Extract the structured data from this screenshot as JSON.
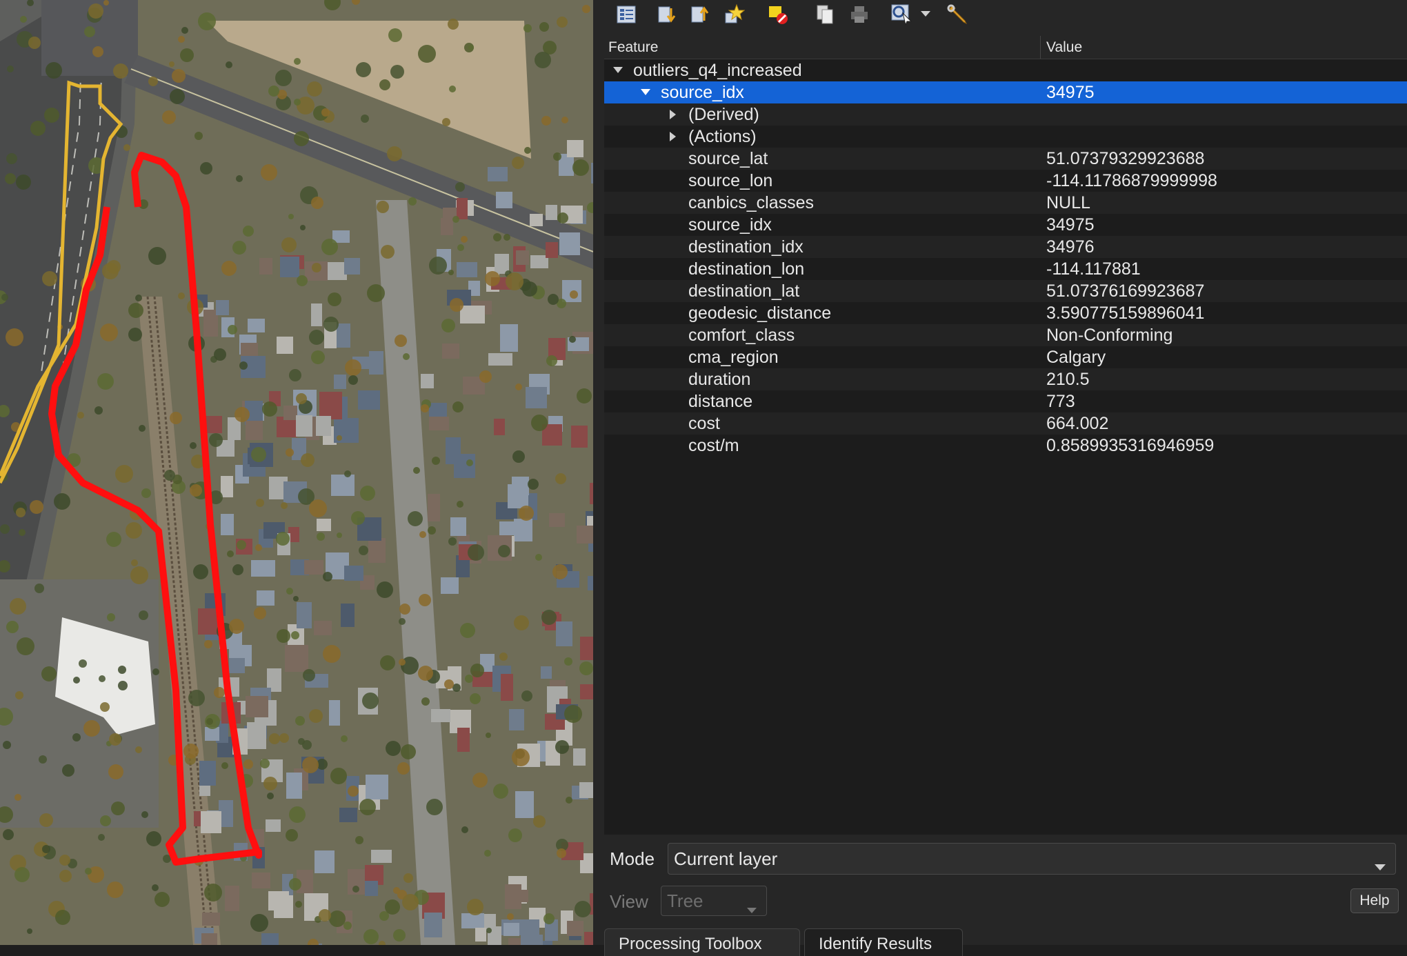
{
  "map": {
    "colors": {
      "route_red": "#ff0f0f",
      "route_yellow": "#e4b531"
    }
  },
  "toolbar": {
    "icons": [
      "expand-tree-icon",
      "expand-all-icon",
      "collapse-all-icon",
      "highlight-icon",
      "deselect-icon",
      "copy-icon",
      "print-icon",
      "identify-mode-icon",
      "dropdown-arrow-icon",
      "settings-wrench-icon"
    ]
  },
  "table": {
    "headers": {
      "feature": "Feature",
      "value": "Value"
    },
    "layer": "outliers_q4_increased",
    "selected_row": {
      "key": "source_idx",
      "value": "34975"
    },
    "groups": [
      "(Derived)",
      "(Actions)"
    ],
    "attributes": [
      {
        "key": "source_lat",
        "value": "51.07379329923688"
      },
      {
        "key": "source_lon",
        "value": "-114.11786879999998"
      },
      {
        "key": "canbics_classes",
        "value": "NULL"
      },
      {
        "key": "source_idx",
        "value": "34975"
      },
      {
        "key": "destination_idx",
        "value": "34976"
      },
      {
        "key": "destination_lon",
        "value": "-114.117881"
      },
      {
        "key": "destination_lat",
        "value": "51.07376169923687"
      },
      {
        "key": "geodesic_distance",
        "value": "3.590775159896041"
      },
      {
        "key": "comfort_class",
        "value": "Non-Conforming"
      },
      {
        "key": "cma_region",
        "value": "Calgary"
      },
      {
        "key": "duration",
        "value": "210.5"
      },
      {
        "key": "distance",
        "value": "773"
      },
      {
        "key": "cost",
        "value": "664.002"
      },
      {
        "key": "cost/m",
        "value": "0.8589935316946959"
      }
    ],
    "colors": {
      "selection": "#1463d6"
    }
  },
  "bottom": {
    "mode_label": "Mode",
    "mode_value": "Current layer",
    "view_label": "View",
    "view_value": "Tree",
    "help_label": "Help",
    "tabs": [
      "Processing Toolbox",
      "Identify Results"
    ]
  }
}
